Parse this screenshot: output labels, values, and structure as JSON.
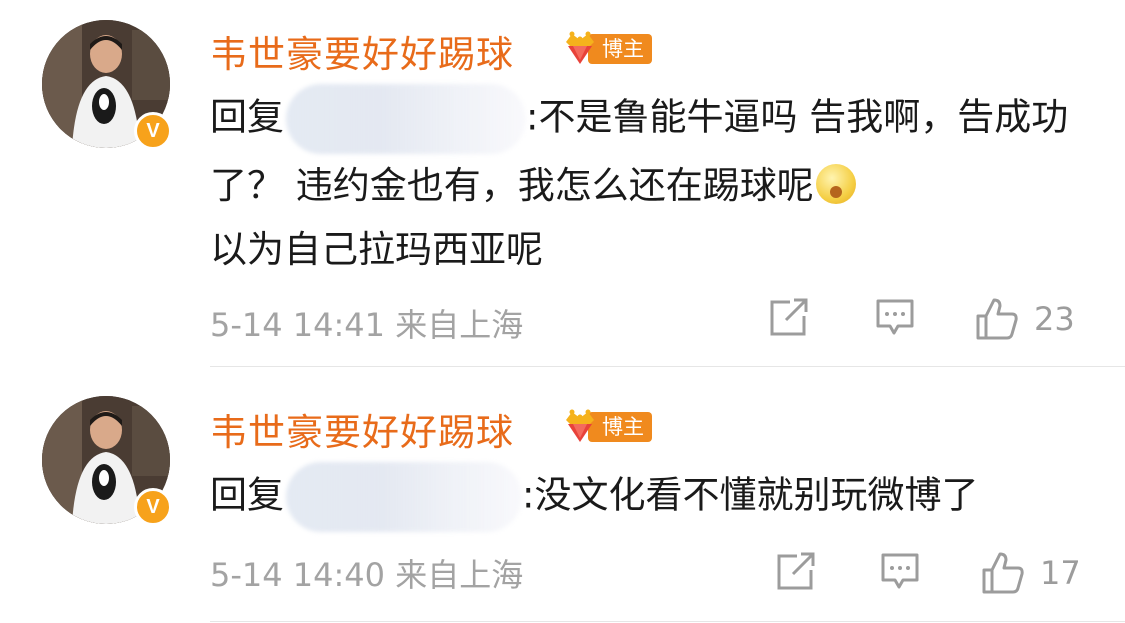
{
  "comments": [
    {
      "username": "韦世豪要好好踢球",
      "badge": "博主",
      "verified_mark": "V",
      "text_prefix": "回复",
      "text_body": ":不是鲁能牛逼吗 告我啊，告成功了？ 违约金也有，我怎么还在踢球呢",
      "text_tail": "以为自己拉玛西亚呢",
      "emoji": "thinking-face-icon",
      "time": "5-14 14:41",
      "location": "来自上海",
      "likes": "23"
    },
    {
      "username": "韦世豪要好好踢球",
      "badge": "博主",
      "verified_mark": "V",
      "text_prefix": "回复",
      "text_body": ":没文化看不懂就别玩微博了",
      "time": "5-14 14:40",
      "location": "来自上海",
      "likes": "17"
    }
  ],
  "colors": {
    "username": "#e86b1a",
    "badge": "#f08a1e",
    "verified": "#f7a21b",
    "meta": "#a3a3a3"
  }
}
